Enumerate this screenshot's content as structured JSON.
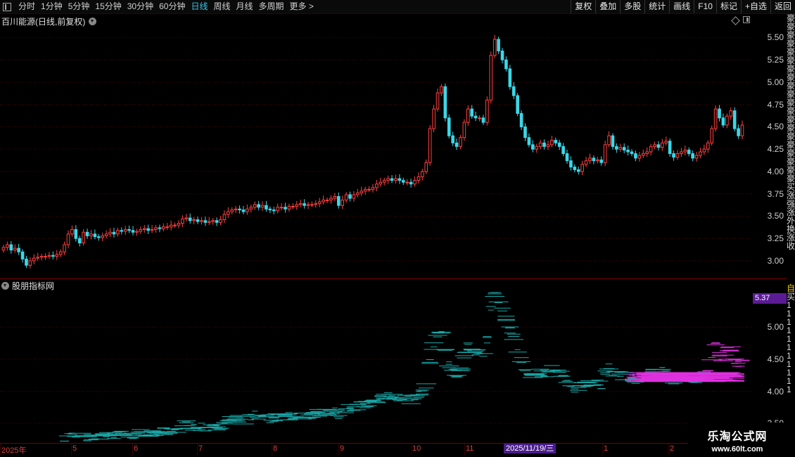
{
  "toolbar": {
    "periods": [
      {
        "label": "分时",
        "active": false
      },
      {
        "label": "1分钟",
        "active": false
      },
      {
        "label": "5分钟",
        "active": false
      },
      {
        "label": "15分钟",
        "active": false
      },
      {
        "label": "30分钟",
        "active": false
      },
      {
        "label": "60分钟",
        "active": false
      },
      {
        "label": "日线",
        "active": true
      },
      {
        "label": "周线",
        "active": false
      },
      {
        "label": "月线",
        "active": false
      },
      {
        "label": "多周期",
        "active": false
      },
      {
        "label": "更多 >",
        "active": false
      }
    ],
    "actions": [
      "复权",
      "叠加",
      "多股",
      "统计",
      "画线",
      "F10",
      "标记",
      "+自选",
      "返回"
    ]
  },
  "main_chart": {
    "title": "百川能源(日线,前复权)",
    "y_ticks": [
      "5.50",
      "5.25",
      "5.00",
      "4.75",
      "4.50",
      "4.25",
      "4.00",
      "3.75",
      "3.50",
      "3.25",
      "3.00"
    ]
  },
  "sub_chart": {
    "title": "股朋指标网",
    "current_price": "5.37",
    "y_ticks": [
      "5.00",
      "4.50",
      "4.00",
      "3.50"
    ],
    "right_digits": [
      "1",
      "1",
      "1",
      "1",
      "1",
      "1",
      "1",
      "1",
      "1",
      "1"
    ]
  },
  "x_axis": {
    "labels": [
      "2025年",
      "5",
      "6",
      "7",
      "8",
      "9",
      "10",
      "11",
      "1",
      "2"
    ],
    "highlight_date": "2025/11/19/三"
  },
  "side_text": [
    "豪",
    "豪",
    "豪",
    "豪",
    "豪",
    "豪",
    "豪",
    "豪",
    "豪",
    "豪",
    "豪",
    "豪",
    "豪",
    "豪",
    "豪",
    "豪",
    "豪",
    "豪",
    "豪",
    "豪",
    "买",
    "涨",
    "强",
    "涨",
    "外",
    "换",
    "涨",
    "收",
    "",
    "",
    "",
    "",
    "自",
    "买",
    "1",
    "1",
    "1",
    "1",
    "1",
    "1",
    "1",
    "1",
    "1",
    "1",
    "1"
  ],
  "watermark": {
    "line1": "乐淘公式网",
    "line2": "www.60lt.com"
  },
  "colors": {
    "up": "#ff4040",
    "down": "#3ad8e8",
    "grid": "#5a0000",
    "sub_cyan": "#1aa8a8",
    "sub_magenta": "#e030e0",
    "active_tab": "#39c6e8"
  },
  "chart_data": {
    "type": "candlestick",
    "ylim": [
      2.85,
      5.7
    ],
    "y_ticks": [
      3.0,
      3.25,
      3.5,
      3.75,
      4.0,
      4.25,
      4.5,
      4.75,
      5.0,
      5.25,
      5.5
    ],
    "closes": [
      3.15,
      3.18,
      3.12,
      3.14,
      3.1,
      3.02,
      2.95,
      3.0,
      3.03,
      3.04,
      3.05,
      3.05,
      3.06,
      3.05,
      3.07,
      3.1,
      3.18,
      3.3,
      3.35,
      3.25,
      3.2,
      3.32,
      3.28,
      3.3,
      3.27,
      3.26,
      3.28,
      3.3,
      3.32,
      3.3,
      3.34,
      3.33,
      3.35,
      3.34,
      3.32,
      3.33,
      3.35,
      3.36,
      3.34,
      3.35,
      3.37,
      3.36,
      3.38,
      3.38,
      3.4,
      3.4,
      3.42,
      3.47,
      3.48,
      3.45,
      3.46,
      3.44,
      3.45,
      3.43,
      3.44,
      3.45,
      3.43,
      3.46,
      3.52,
      3.55,
      3.57,
      3.58,
      3.57,
      3.55,
      3.58,
      3.6,
      3.63,
      3.6,
      3.62,
      3.58,
      3.57,
      3.56,
      3.6,
      3.6,
      3.58,
      3.61,
      3.61,
      3.63,
      3.64,
      3.62,
      3.63,
      3.63,
      3.64,
      3.66,
      3.68,
      3.68,
      3.7,
      3.72,
      3.62,
      3.68,
      3.74,
      3.7,
      3.74,
      3.76,
      3.78,
      3.8,
      3.8,
      3.82,
      3.86,
      3.88,
      3.9,
      3.92,
      3.9,
      3.92,
      3.9,
      3.88,
      3.88,
      3.86,
      3.9,
      3.94,
      4.0,
      4.1,
      4.48,
      4.7,
      4.88,
      4.95,
      4.6,
      4.4,
      4.32,
      4.28,
      4.38,
      4.55,
      4.7,
      4.62,
      4.6,
      4.6,
      4.55,
      4.8,
      5.3,
      5.48,
      5.35,
      5.25,
      5.15,
      4.95,
      4.85,
      4.65,
      4.5,
      4.38,
      4.3,
      4.25,
      4.28,
      4.32,
      4.28,
      4.3,
      4.35,
      4.32,
      4.28,
      4.2,
      4.12,
      4.05,
      4.02,
      4.0,
      4.08,
      4.12,
      4.15,
      4.12,
      4.13,
      4.1,
      4.3,
      4.4,
      4.28,
      4.25,
      4.27,
      4.24,
      4.22,
      4.2,
      4.15,
      4.18,
      4.2,
      4.22,
      4.28,
      4.3,
      4.27,
      4.32,
      4.34,
      4.2,
      4.16,
      4.2,
      4.22,
      4.24,
      4.2,
      4.15,
      4.18,
      4.22,
      4.25,
      4.32,
      4.48,
      4.7,
      4.6,
      4.52,
      4.62,
      4.68,
      4.48,
      4.4,
      4.52
    ]
  }
}
